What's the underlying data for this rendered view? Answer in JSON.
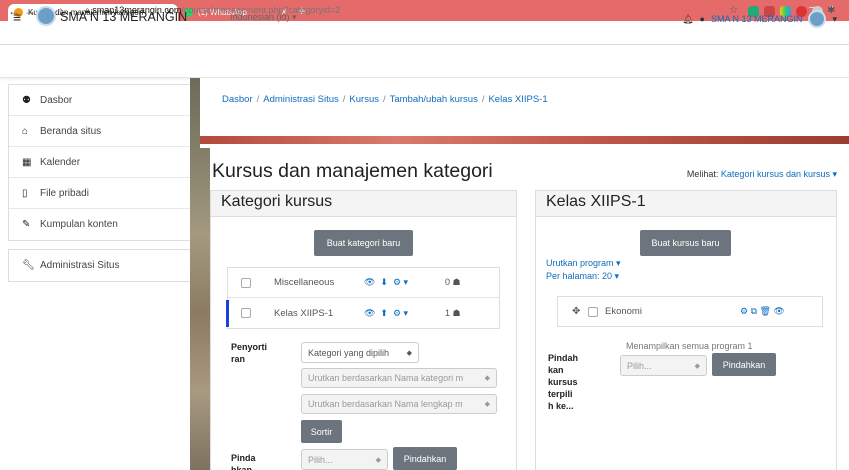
{
  "browser": {
    "tabs": [
      {
        "title": "Kursus dan manajemen kategori",
        "close": "×"
      },
      {
        "title": "(1) WhatsApp",
        "close": "×"
      }
    ],
    "new_tab": "+",
    "window_controls": "– ▫",
    "url_host": "sman13merangin.com",
    "url_path": "/course/management.php?categoryid=2"
  },
  "header": {
    "site_name": "SMA N 13 MERANGIN",
    "language": "Indonesian (id) ▾",
    "user_name": "SMA N 13 MERANGIN"
  },
  "sidebar": {
    "group1": [
      {
        "label": "Dasbor",
        "icon": "dashboard-icon",
        "glyph": "⚉"
      },
      {
        "label": "Beranda situs",
        "icon": "home-icon",
        "glyph": "⌂"
      },
      {
        "label": "Kalender",
        "icon": "calendar-icon",
        "glyph": "▦"
      },
      {
        "label": "File pribadi",
        "icon": "file-icon",
        "glyph": "▯"
      },
      {
        "label": "Kumpulan konten",
        "icon": "pencil-icon",
        "glyph": "✎"
      }
    ],
    "group2": [
      {
        "label": "Administrasi Situs",
        "icon": "wrench-icon",
        "glyph": "✗"
      }
    ]
  },
  "breadcrumb": [
    "Dasbor",
    "Administrasi Situs",
    "Kursus",
    "Tambah/ubah kursus",
    "Kelas XIIPS-1"
  ],
  "page": {
    "title": "Kursus dan manajemen kategori",
    "viewing_label": "Melihat:",
    "viewing_value": "Kategori kursus dan kursus ▾"
  },
  "categories": {
    "heading": "Kategori kursus",
    "new_button": "Buat kategori baru",
    "rows": [
      {
        "name": "Miscellaneous",
        "count": "0"
      },
      {
        "name": "Kelas XIIPS-1",
        "count": "1"
      }
    ],
    "sort_label": "Penyortiran",
    "sort_select": "Kategori yang dipilih",
    "sort_name": "Urutkan berdasarkan Nama kategori m",
    "sort_fullname": "Urutkan berdasarkan Nama lengkap m",
    "sort_button": "Sortir",
    "move_label": "Pindahkan",
    "move_select": "Pilih...",
    "move_button": "Pindahkan"
  },
  "courses": {
    "heading": "Kelas XIIPS-1",
    "new_button": "Buat kursus baru",
    "sort_link": "Urutkan program ▾",
    "per_page": "Per halaman: 20 ▾",
    "items": [
      {
        "name": "Ekonomi"
      }
    ],
    "showing": "Menampilkan semua program 1",
    "move_label": "Pindahkan kursus terpilih ke...",
    "move_select": "Pilih...",
    "move_button": "Pindahkan"
  },
  "colors": {
    "tabbar": "#e56a6a",
    "link": "#0f6cbf",
    "button": "#6c757d",
    "active_marker": "#1f3fd6"
  }
}
